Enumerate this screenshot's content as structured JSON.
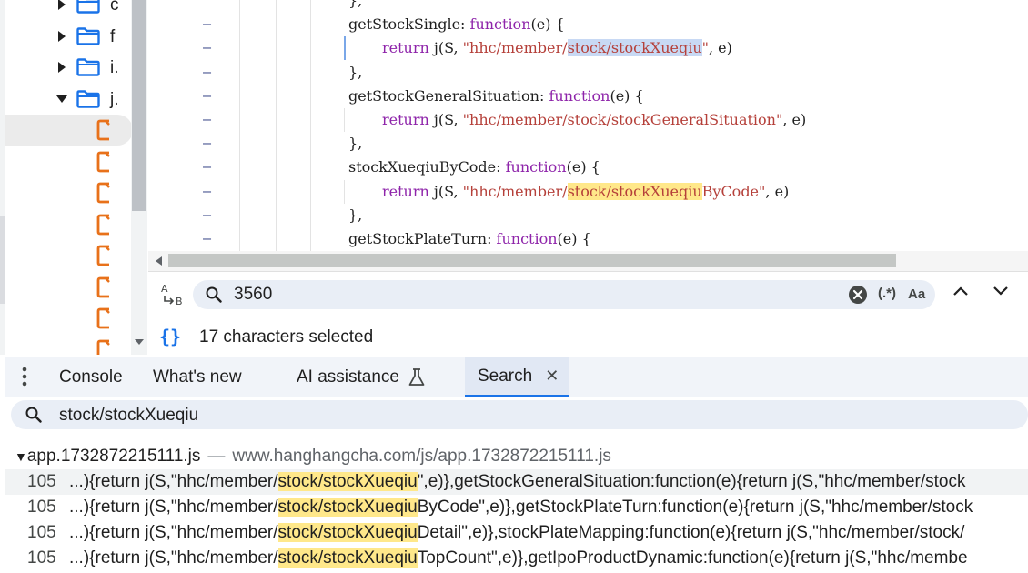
{
  "tree": {
    "rows": [
      {
        "type": "folder",
        "label": "c",
        "expanded": false
      },
      {
        "type": "folder",
        "label": "f",
        "expanded": false
      },
      {
        "type": "folder",
        "label": "i.",
        "expanded": false
      },
      {
        "type": "folder",
        "label": "j.",
        "expanded": true
      },
      {
        "type": "file",
        "selected": true
      },
      {
        "type": "file"
      },
      {
        "type": "file"
      },
      {
        "type": "file"
      },
      {
        "type": "file"
      },
      {
        "type": "file"
      },
      {
        "type": "file"
      },
      {
        "type": "file"
      }
    ]
  },
  "editor": {
    "lines": [
      {
        "gutter": "",
        "segments": [
          {
            "t": "},"
          }
        ],
        "indent": false
      },
      {
        "gutter": "–",
        "indent": false,
        "segments": [
          {
            "t": "getStockSingle: "
          },
          {
            "t": "function",
            "c": "kw"
          },
          {
            "t": "(e) {"
          }
        ]
      },
      {
        "gutter": "–",
        "indent": true,
        "caret": true,
        "segments": [
          {
            "t": "return",
            "c": "kw"
          },
          {
            "t": " j(S, "
          },
          {
            "t": "\"hhc/member/",
            "c": "str"
          },
          {
            "t": "stock/stockXueqiu",
            "c": "str hl-sel"
          },
          {
            "t": "\"",
            "c": "str"
          },
          {
            "t": ", e)"
          }
        ]
      },
      {
        "gutter": "–",
        "indent": false,
        "segments": [
          {
            "t": "},"
          }
        ]
      },
      {
        "gutter": "–",
        "indent": false,
        "segments": [
          {
            "t": "getStockGeneralSituation: "
          },
          {
            "t": "function",
            "c": "kw"
          },
          {
            "t": "(e) {"
          }
        ]
      },
      {
        "gutter": "–",
        "indent": true,
        "segments": [
          {
            "t": "return",
            "c": "kw"
          },
          {
            "t": " j(S, "
          },
          {
            "t": "\"hhc/member/stock/stockGeneralSituation\"",
            "c": "str"
          },
          {
            "t": ", e)"
          }
        ]
      },
      {
        "gutter": "–",
        "indent": false,
        "segments": [
          {
            "t": "},"
          }
        ]
      },
      {
        "gutter": "–",
        "indent": false,
        "segments": [
          {
            "t": "stockXueqiuByCode: "
          },
          {
            "t": "function",
            "c": "kw"
          },
          {
            "t": "(e) {"
          }
        ]
      },
      {
        "gutter": "–",
        "indent": true,
        "segments": [
          {
            "t": "return",
            "c": "kw"
          },
          {
            "t": " j(S, "
          },
          {
            "t": "\"hhc/member/",
            "c": "str"
          },
          {
            "t": "stock/stockXueqiu",
            "c": "str hl-match"
          },
          {
            "t": "ByCode\"",
            "c": "str"
          },
          {
            "t": ", e)"
          }
        ]
      },
      {
        "gutter": "–",
        "indent": false,
        "segments": [
          {
            "t": "},"
          }
        ]
      },
      {
        "gutter": "–",
        "indent": false,
        "segments": [
          {
            "t": "getStockPlateTurn: "
          },
          {
            "t": "function",
            "c": "kw"
          },
          {
            "t": "(e) {"
          }
        ]
      }
    ]
  },
  "findbar": {
    "query": "3560",
    "regex_label": "(.*)",
    "case_label": "Aa"
  },
  "status": {
    "braces": "{}",
    "message": "17 characters selected"
  },
  "tabs": [
    {
      "label": "Console",
      "active": false
    },
    {
      "label": "What's new",
      "active": false
    },
    {
      "label": "AI assistance",
      "active": false,
      "flask": true
    },
    {
      "label": "Search",
      "active": true,
      "closable": true
    }
  ],
  "search": {
    "query": "stock/stockXueqiu",
    "file_name": "app.1732872215111.js",
    "separator": "—",
    "file_url": "www.hanghangcha.com/js/app.1732872215111.js",
    "results": [
      {
        "line": "105",
        "selected": true,
        "pre": "...){return j(S,\"hhc/member/",
        "match": "stock/stockXueqiu",
        "post": "\",e)},getStockGeneralSituation:function(e){return j(S,\"hhc/member/stock"
      },
      {
        "line": "105",
        "selected": false,
        "pre": "...){return j(S,\"hhc/member/",
        "match": "stock/stockXueqiu",
        "post": "ByCode\",e)},getStockPlateTurn:function(e){return j(S,\"hhc/member/stock"
      },
      {
        "line": "105",
        "selected": false,
        "pre": "...){return j(S,\"hhc/member/",
        "match": "stock/stockXueqiu",
        "post": "Detail\",e)},stockPlateMapping:function(e){return j(S,\"hhc/member/stock/"
      },
      {
        "line": "105",
        "selected": false,
        "pre": "...){return j(S,\"hhc/member/",
        "match": "stock/stockXueqiu",
        "post": "TopCount\",e)},getIpoProductDynamic:function(e){return j(S,\"hhc/membe"
      }
    ]
  }
}
